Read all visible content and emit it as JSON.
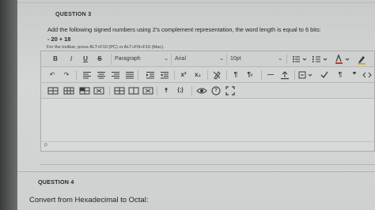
{
  "question3": {
    "title": "QUESTION 3",
    "prompt": "Add the following signed numbers using 2's complement representation, the word length is equal to 6 bits:",
    "expression": "- 20 + 18",
    "toolbar_hint": "For the toolbar, press ALT+F10 (PC) or ALT+FN+F10 (Mac)."
  },
  "editor": {
    "row1": {
      "bold": "B",
      "italic": "I",
      "underline": "U",
      "strike": "S",
      "paragraph": "Paragraph",
      "font": "Arial",
      "size": "10pt",
      "chevron": "⌄"
    },
    "row2": {
      "undo": "↶",
      "redo": "↷",
      "superscript": "x²",
      "subscript": "x₂",
      "ltr": "¶",
      "rtl": "¶‹",
      "hr": "—",
      "pilcrow": "¶",
      "quote": "❞"
    },
    "row3": {
      "person": "☨",
      "code": "{;}",
      "help": "?"
    },
    "status_path": "P"
  },
  "question4": {
    "title": "QUESTION 4",
    "prompt": "Convert from Hexadecimal  to Octal:"
  }
}
